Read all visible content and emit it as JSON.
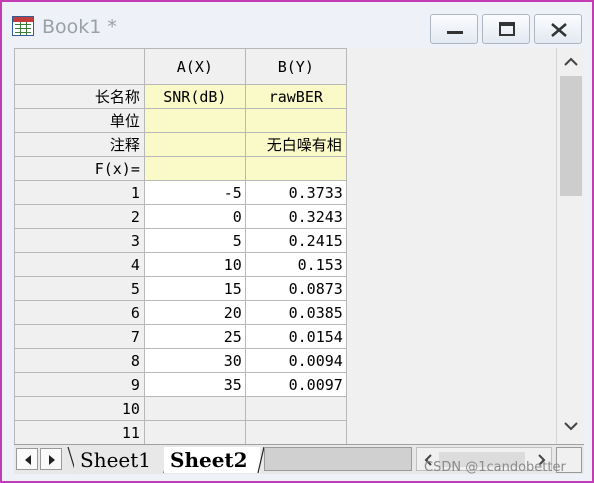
{
  "window": {
    "title": "Book1 *",
    "icon": "workbook-icon"
  },
  "columns": {
    "corner": "",
    "a_header": "A(X)",
    "b_header": "B(Y)"
  },
  "meta_rows": {
    "long_name_label": "长名称",
    "units_label": "单位",
    "comments_label": "注释",
    "fx_label": "F(x)=",
    "a_long_name": "SNR(dB)",
    "b_long_name": "rawBER",
    "a_units": "",
    "b_units": "",
    "a_comments": "",
    "b_comments": "无白噪有相",
    "a_fx": "",
    "b_fx": ""
  },
  "rows": [
    {
      "n": "1",
      "a": "-5",
      "b": "0.3733"
    },
    {
      "n": "2",
      "a": "0",
      "b": "0.3243"
    },
    {
      "n": "3",
      "a": "5",
      "b": "0.2415"
    },
    {
      "n": "4",
      "a": "10",
      "b": "0.153"
    },
    {
      "n": "5",
      "a": "15",
      "b": "0.0873"
    },
    {
      "n": "6",
      "a": "20",
      "b": "0.0385"
    },
    {
      "n": "7",
      "a": "25",
      "b": "0.0154"
    },
    {
      "n": "8",
      "a": "30",
      "b": "0.0094"
    },
    {
      "n": "9",
      "a": "35",
      "b": "0.0097"
    },
    {
      "n": "10",
      "a": "",
      "b": ""
    },
    {
      "n": "11",
      "a": "",
      "b": ""
    }
  ],
  "sheets": {
    "tab1": "Sheet1",
    "tab2": "Sheet2",
    "active": "Sheet2"
  },
  "watermark": "CSDN @1candobetter",
  "colors": {
    "window_border": "#c23cb4",
    "meta_cell": "#fafac8",
    "header_bg": "#f0f0f0"
  }
}
